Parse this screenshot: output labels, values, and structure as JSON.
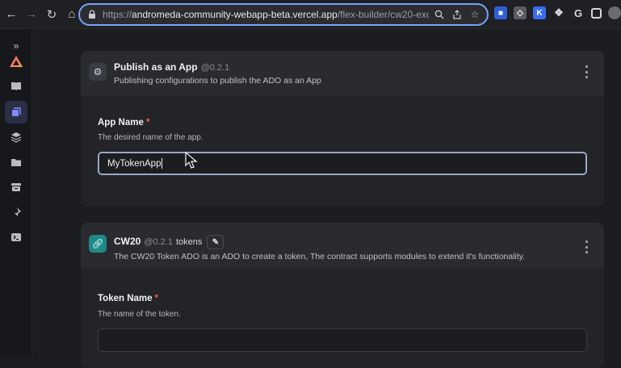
{
  "browser": {
    "url_prefix": "https://",
    "url_host": "andromeda-community-webapp-beta.vercel.app",
    "url_path": "/flex-builder/cw20-exch..."
  },
  "sidebar": {
    "items": [
      {
        "icon": "expand-chevrons-icon"
      },
      {
        "icon": "andromeda-logo-icon"
      },
      {
        "icon": "book-icon"
      },
      {
        "icon": "cube-icon"
      },
      {
        "icon": "layers-icon"
      },
      {
        "icon": "folder-icon"
      },
      {
        "icon": "archive-icon"
      },
      {
        "icon": "pin-icon"
      },
      {
        "icon": "terminal-icon"
      }
    ]
  },
  "publish_card": {
    "title": "Publish as an App",
    "version": "@0.2.1",
    "subtitle": "Publishing configurations to publish the ADO as an App",
    "field": {
      "label": "App Name",
      "required_mark": "*",
      "description": "The desired name of the app.",
      "value": "MyTokenApp"
    }
  },
  "cw20_card": {
    "title": "CW20",
    "version": "@0.2.1",
    "tag": "tokens",
    "subtitle": "The CW20 Token ADO is an ADO to create a token, The contract supports modules to extend it's functionality.",
    "field": {
      "label": "Token Name",
      "required_mark": "*",
      "description": "The name of the token.",
      "value": ""
    }
  },
  "colors": {
    "accent_focus": "#7aa2ff",
    "required": "#ff5c5c",
    "cw20_icon_bg": "#1d8a87",
    "publish_icon_bg": "#3a3c44"
  }
}
